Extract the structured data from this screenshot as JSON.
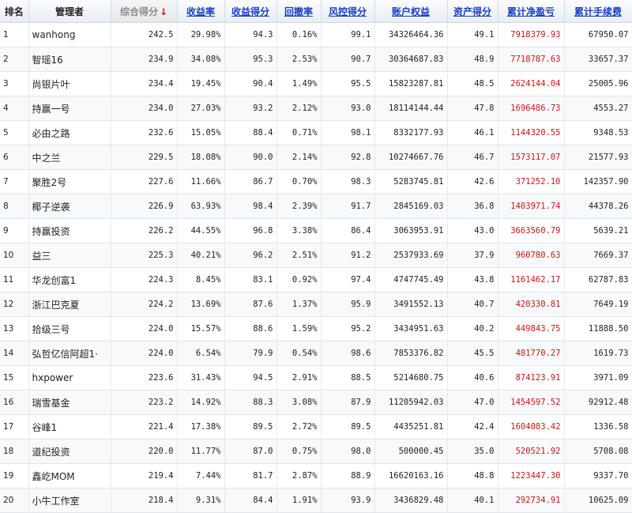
{
  "columns": {
    "rank": "排名",
    "manager": "管理者",
    "total_score": "综合得分",
    "return_rate": "收益率",
    "return_score": "收益得分",
    "drawdown": "回撤率",
    "risk_score": "风控得分",
    "equity": "账户权益",
    "asset_score": "资产得分",
    "cum_profit": "累计净盈亏",
    "cum_fee": "累计手续费"
  },
  "sort_indicator": "down-arrow-icon",
  "colors": {
    "profit": "#d21414",
    "link": "#1a3fc4"
  },
  "rows": [
    {
      "rank": "1",
      "manager": "wanhong",
      "total_score": "242.5",
      "return_rate": "29.98%",
      "return_score": "94.3",
      "drawdown": "0.16%",
      "risk_score": "99.1",
      "equity": "34326464.36",
      "asset_score": "49.1",
      "cum_profit": "7918379.93",
      "cum_fee": "67950.07"
    },
    {
      "rank": "2",
      "manager": "智瑶16",
      "total_score": "234.9",
      "return_rate": "34.08%",
      "return_score": "95.3",
      "drawdown": "2.53%",
      "risk_score": "90.7",
      "equity": "30364687.83",
      "asset_score": "48.9",
      "cum_profit": "7718787.63",
      "cum_fee": "33657.37"
    },
    {
      "rank": "3",
      "manager": "尚银片叶",
      "total_score": "234.4",
      "return_rate": "19.45%",
      "return_score": "90.4",
      "drawdown": "1.49%",
      "risk_score": "95.5",
      "equity": "15823287.81",
      "asset_score": "48.5",
      "cum_profit": "2624144.04",
      "cum_fee": "25005.96"
    },
    {
      "rank": "4",
      "manager": "持赢一号",
      "total_score": "234.0",
      "return_rate": "27.03%",
      "return_score": "93.2",
      "drawdown": "2.12%",
      "risk_score": "93.0",
      "equity": "18114144.44",
      "asset_score": "47.8",
      "cum_profit": "1696486.73",
      "cum_fee": "4553.27"
    },
    {
      "rank": "5",
      "manager": "必由之路",
      "total_score": "232.6",
      "return_rate": "15.05%",
      "return_score": "88.4",
      "drawdown": "0.71%",
      "risk_score": "98.1",
      "equity": "8332177.93",
      "asset_score": "46.1",
      "cum_profit": "1144320.55",
      "cum_fee": "9348.53"
    },
    {
      "rank": "6",
      "manager": "中之兰",
      "total_score": "229.5",
      "return_rate": "18.08%",
      "return_score": "90.0",
      "drawdown": "2.14%",
      "risk_score": "92.8",
      "equity": "10274667.76",
      "asset_score": "46.7",
      "cum_profit": "1573117.07",
      "cum_fee": "21577.93"
    },
    {
      "rank": "7",
      "manager": "聚胜2号",
      "total_score": "227.6",
      "return_rate": "11.66%",
      "return_score": "86.7",
      "drawdown": "0.70%",
      "risk_score": "98.3",
      "equity": "5283745.81",
      "asset_score": "42.6",
      "cum_profit": "371252.10",
      "cum_fee": "142357.90"
    },
    {
      "rank": "8",
      "manager": "椰子逆袭",
      "total_score": "226.9",
      "return_rate": "63.93%",
      "return_score": "98.4",
      "drawdown": "2.39%",
      "risk_score": "91.7",
      "equity": "2845169.03",
      "asset_score": "36.8",
      "cum_profit": "1403971.74",
      "cum_fee": "44378.26"
    },
    {
      "rank": "9",
      "manager": "持赢投资",
      "total_score": "226.2",
      "return_rate": "44.55%",
      "return_score": "96.8",
      "drawdown": "3.38%",
      "risk_score": "86.4",
      "equity": "3063953.91",
      "asset_score": "43.0",
      "cum_profit": "3663560.79",
      "cum_fee": "5639.21"
    },
    {
      "rank": "10",
      "manager": "益三",
      "total_score": "225.3",
      "return_rate": "40.21%",
      "return_score": "96.2",
      "drawdown": "2.51%",
      "risk_score": "91.2",
      "equity": "2537933.69",
      "asset_score": "37.9",
      "cum_profit": "960780.63",
      "cum_fee": "7669.37"
    },
    {
      "rank": "11",
      "manager": "华龙创富1",
      "total_score": "224.3",
      "return_rate": "8.45%",
      "return_score": "83.1",
      "drawdown": "0.92%",
      "risk_score": "97.4",
      "equity": "4747745.49",
      "asset_score": "43.8",
      "cum_profit": "1161462.17",
      "cum_fee": "62787.83"
    },
    {
      "rank": "12",
      "manager": "浙江巴克夏",
      "total_score": "224.2",
      "return_rate": "13.69%",
      "return_score": "87.6",
      "drawdown": "1.37%",
      "risk_score": "95.9",
      "equity": "3491552.13",
      "asset_score": "40.7",
      "cum_profit": "420330.81",
      "cum_fee": "7649.19"
    },
    {
      "rank": "13",
      "manager": "拾级三号",
      "total_score": "224.0",
      "return_rate": "15.57%",
      "return_score": "88.6",
      "drawdown": "1.59%",
      "risk_score": "95.2",
      "equity": "3434951.63",
      "asset_score": "40.2",
      "cum_profit": "449843.75",
      "cum_fee": "11888.50"
    },
    {
      "rank": "14",
      "manager": "弘哲亿信阿超1·",
      "total_score": "224.0",
      "return_rate": "6.54%",
      "return_score": "79.9",
      "drawdown": "0.54%",
      "risk_score": "98.6",
      "equity": "7853376.82",
      "asset_score": "45.5",
      "cum_profit": "481770.27",
      "cum_fee": "1619.73"
    },
    {
      "rank": "15",
      "manager": "hxpower",
      "total_score": "223.6",
      "return_rate": "31.43%",
      "return_score": "94.5",
      "drawdown": "2.91%",
      "risk_score": "88.5",
      "equity": "5214680.75",
      "asset_score": "40.6",
      "cum_profit": "874123.91",
      "cum_fee": "3971.09"
    },
    {
      "rank": "16",
      "manager": "瑞雪基金",
      "total_score": "223.2",
      "return_rate": "14.92%",
      "return_score": "88.3",
      "drawdown": "3.08%",
      "risk_score": "87.9",
      "equity": "11205942.03",
      "asset_score": "47.0",
      "cum_profit": "1454597.52",
      "cum_fee": "92912.48"
    },
    {
      "rank": "17",
      "manager": "谷峰1",
      "total_score": "221.4",
      "return_rate": "17.38%",
      "return_score": "89.5",
      "drawdown": "2.72%",
      "risk_score": "89.5",
      "equity": "4435251.81",
      "asset_score": "42.4",
      "cum_profit": "1604083.42",
      "cum_fee": "1336.58"
    },
    {
      "rank": "18",
      "manager": "道纪投资",
      "total_score": "220.0",
      "return_rate": "11.77%",
      "return_score": "87.0",
      "drawdown": "0.75%",
      "risk_score": "98.0",
      "equity": "500000.45",
      "asset_score": "35.0",
      "cum_profit": "520521.92",
      "cum_fee": "5708.08"
    },
    {
      "rank": "19",
      "manager": "鑫屹MOM",
      "total_score": "219.4",
      "return_rate": "7.44%",
      "return_score": "81.7",
      "drawdown": "2.87%",
      "risk_score": "88.9",
      "equity": "16620163.16",
      "asset_score": "48.8",
      "cum_profit": "1223447.30",
      "cum_fee": "9337.70"
    },
    {
      "rank": "20",
      "manager": "小牛工作室",
      "total_score": "218.4",
      "return_rate": "9.31%",
      "return_score": "84.4",
      "drawdown": "1.91%",
      "risk_score": "93.9",
      "equity": "3436829.48",
      "asset_score": "40.1",
      "cum_profit": "292734.91",
      "cum_fee": "10625.09"
    }
  ]
}
